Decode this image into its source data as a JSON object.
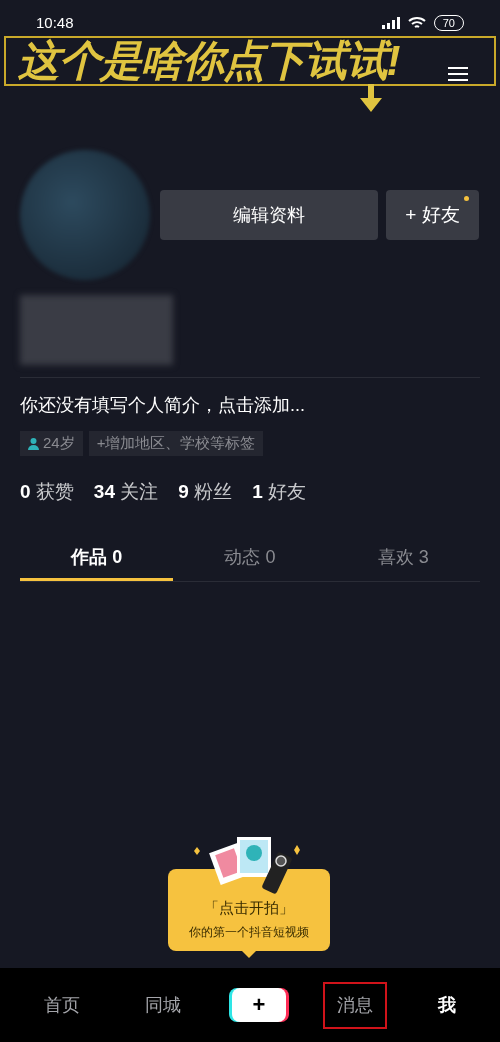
{
  "status_bar": {
    "time": "10:48",
    "battery": "70"
  },
  "banner": {
    "text": "这个是啥你点下试试!"
  },
  "profile": {
    "edit_button": "编辑资料",
    "add_friend_button": "+ 好友",
    "add_friend_dot": true,
    "bio": "你还没有填写个人简介，点击添加...",
    "tags": [
      {
        "kind": "age",
        "label": "24岁"
      },
      {
        "kind": "add",
        "label": "+增加地区、学校等标签"
      }
    ],
    "stats": [
      "**0** 获赞",
      "**34** 关注",
      "**9** 粉丝",
      "**1** 好友"
    ]
  },
  "tabs": [
    {
      "label": "作品 0",
      "selected": true
    },
    {
      "label": "动态 0",
      "selected": false
    },
    {
      "label": "喜欢 3",
      "selected": false
    }
  ],
  "tooltip": {
    "title": "「点击开拍」",
    "subtitle": "你的第一个抖音短视频"
  },
  "nav": [
    {
      "kind": "tab",
      "label": "首页",
      "selected": false,
      "highlighted": false
    },
    {
      "kind": "tab",
      "label": "同城",
      "selected": false,
      "highlighted": false
    },
    {
      "kind": "create",
      "label": "+",
      "selected": false,
      "highlighted": false
    },
    {
      "kind": "tab",
      "label": "消息",
      "selected": false,
      "highlighted": true
    },
    {
      "kind": "tab",
      "label": "我",
      "selected": true,
      "highlighted": false
    }
  ]
}
